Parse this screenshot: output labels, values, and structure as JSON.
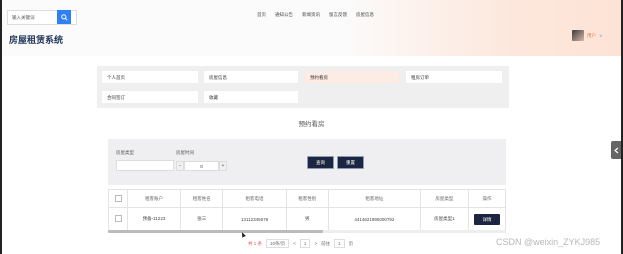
{
  "header": {
    "search_placeholder": "输入关键词",
    "nav": [
      "首页",
      "通知公告",
      "新闻资讯",
      "留言反馈",
      "房屋信息"
    ],
    "site_title": "房屋租赁系统",
    "user_name": "用户",
    "user_caret": "∨"
  },
  "menu": {
    "items": [
      {
        "label": "个人首页",
        "active": false
      },
      {
        "label": "房屋信息",
        "active": false
      },
      {
        "label": "预约看房",
        "active": true
      },
      {
        "label": "租房订单",
        "active": false
      },
      {
        "label": "合同签订",
        "active": false
      },
      {
        "label": "收藏",
        "active": false
      }
    ]
  },
  "page": {
    "section_title": "预约看房"
  },
  "filters": {
    "house_type_label": "房屋类型",
    "house_type_value": "",
    "viewing_time_label": "房屋时间",
    "stepper_value": "0",
    "stepper_minus": "−",
    "stepper_plus": "+",
    "search_button": "查询",
    "reset_button": "重置"
  },
  "table": {
    "headers": [
      "",
      "租客账户",
      "租客姓名",
      "租客电话",
      "租客性别",
      "租客地址",
      "房屋类型",
      "操作"
    ],
    "rows": [
      [
        "",
        "预备-11223",
        "张三",
        "13112345678",
        "男",
        "4414621995000792",
        "房屋类型1",
        "详情"
      ]
    ]
  },
  "pagination": {
    "total": "共 1 条",
    "per_page": "10条/页",
    "prev": "<",
    "page": "1",
    "next": ">",
    "goto_label": "前往",
    "goto_value": "1",
    "page_suffix": "页"
  },
  "watermark": "CSDN @weixin_ZYKJ985",
  "colors": {
    "accent": "#2f80f5",
    "dark_button": "#1c2640",
    "active_menu_bg": "#fdece3",
    "title": "#253a5e"
  }
}
